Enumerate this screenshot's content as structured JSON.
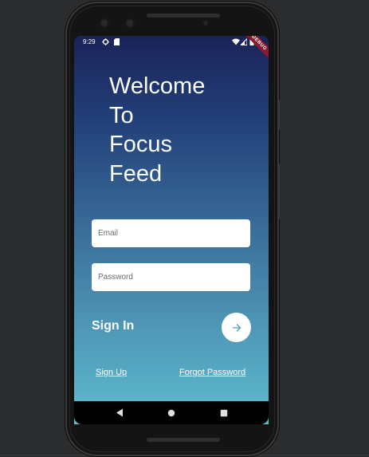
{
  "status_bar": {
    "time": "9:29",
    "debug_banner": "DEBUG"
  },
  "welcome": {
    "lines": [
      "Welcome",
      "To",
      "Focus",
      "Feed"
    ]
  },
  "form": {
    "email_placeholder": "Email",
    "password_placeholder": "Password",
    "sign_in_label": "Sign In"
  },
  "links": {
    "sign_up": "Sign Up",
    "forgot_password": "Forgot Password"
  },
  "icons": {
    "submit": "arrow-right-icon",
    "nav_back": "triangle-back-icon",
    "nav_home": "circle-home-icon",
    "nav_recents": "square-recents-icon"
  },
  "colors": {
    "gradient_top": "#1a2358",
    "gradient_bottom": "#5dbdd0",
    "accent": "#4a9fbc",
    "debug_banner": "#8b1a2c"
  }
}
